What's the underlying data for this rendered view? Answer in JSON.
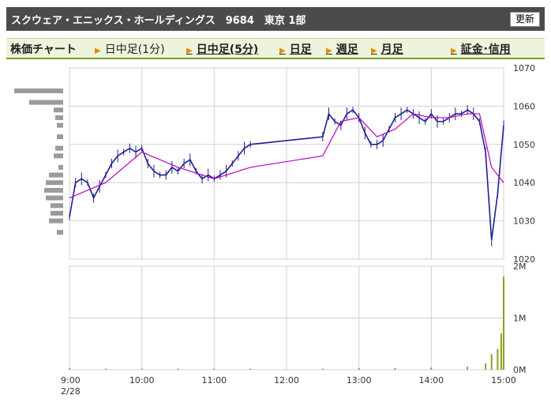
{
  "header": {
    "title": "スクウェア・エニックス・ホールディングス　9684　東京 1部",
    "refresh_label": "更新"
  },
  "nav": {
    "chart_label": "株価チャート",
    "items": [
      {
        "label": "日中足(1分)",
        "link": false
      },
      {
        "label": "日中足(5分)",
        "link": true
      },
      {
        "label": "日足",
        "link": true
      },
      {
        "label": "週足",
        "link": true
      },
      {
        "label": "月足",
        "link": true
      },
      {
        "label": "証金･信用",
        "link": true
      }
    ]
  },
  "colors": {
    "candle": "#1f1f8f",
    "moving_average": "#c000c0",
    "volume": "#8aa21e",
    "grid": "#d0d0d0",
    "volume_profile": "#9a9a9a",
    "nav_accent": "#e48b00"
  },
  "chart_data": [
    {
      "type": "line",
      "title": "",
      "xlabel": "",
      "ylabel": "",
      "y_axis_side": "right",
      "ylim": [
        1020,
        1070
      ],
      "y_ticks": [
        "1070",
        "1060",
        "1050",
        "1040",
        "1030",
        "1020"
      ],
      "x_ticks": [
        "9:00",
        "10:00",
        "11:00",
        "12:00",
        "13:00",
        "14:00",
        "15:00"
      ],
      "date_label": "2/28",
      "grid": true,
      "series": [
        {
          "x": [
            "9:00",
            "9:05",
            "9:10",
            "9:15",
            "9:20",
            "9:25",
            "9:30",
            "9:35",
            "9:40",
            "9:45",
            "9:50",
            "9:55",
            "10:00",
            "10:05",
            "10:10",
            "10:15",
            "10:20",
            "10:25",
            "10:30",
            "10:35",
            "10:40",
            "10:45",
            "10:50",
            "10:55",
            "11:00",
            "11:05",
            "11:10",
            "11:15",
            "11:20",
            "11:25",
            "11:30",
            "12:30",
            "12:35",
            "12:40",
            "12:45",
            "12:50",
            "12:55",
            "13:00",
            "13:05",
            "13:10",
            "13:15",
            "13:20",
            "13:25",
            "13:30",
            "13:35",
            "13:40",
            "13:45",
            "13:50",
            "13:55",
            "14:00",
            "14:05",
            "14:10",
            "14:15",
            "14:20",
            "14:25",
            "14:30",
            "14:35",
            "14:40",
            "14:45",
            "14:50",
            "14:55",
            "15:00"
          ],
          "values": [
            1031,
            1040,
            1041,
            1040,
            1036,
            1039,
            1042,
            1045,
            1047,
            1048,
            1049,
            1048,
            1049,
            1045,
            1043,
            1042,
            1042,
            1044,
            1043,
            1045,
            1046,
            1043,
            1041,
            1042,
            1041,
            1042,
            1043,
            1045,
            1047,
            1049,
            1050,
            1052,
            1058,
            1056,
            1055,
            1058,
            1059,
            1057,
            1053,
            1050,
            1050,
            1051,
            1054,
            1057,
            1058,
            1059,
            1058,
            1057,
            1056,
            1058,
            1056,
            1056,
            1057,
            1058,
            1058,
            1059,
            1058,
            1056,
            1048,
            1025,
            1037,
            1055
          ]
        },
        {
          "x": [
            "9:00",
            "9:30",
            "10:00",
            "10:30",
            "11:00",
            "11:30",
            "12:30",
            "12:45",
            "13:00",
            "13:15",
            "13:30",
            "13:45",
            "14:00",
            "14:15",
            "14:30",
            "14:40",
            "14:50",
            "15:00"
          ],
          "values": [
            1036,
            1040,
            1048,
            1044,
            1041,
            1044,
            1047,
            1056,
            1057,
            1052,
            1054,
            1058,
            1057,
            1057,
            1058,
            1058,
            1044,
            1040
          ]
        }
      ]
    },
    {
      "type": "bar",
      "title": "",
      "ylim": [
        0,
        2000000
      ],
      "y_ticks": [
        "2M",
        "1M",
        "0M"
      ],
      "x": [
        "9:00",
        "9:30",
        "10:00",
        "10:30",
        "11:00",
        "11:30",
        "12:30",
        "13:00",
        "13:30",
        "14:00",
        "14:30",
        "14:45",
        "14:50",
        "14:55",
        "14:58",
        "15:00"
      ],
      "values": [
        30000,
        20000,
        20000,
        20000,
        20000,
        20000,
        20000,
        30000,
        30000,
        40000,
        60000,
        120000,
        300000,
        400000,
        700000,
        1800000
      ]
    },
    {
      "type": "bar",
      "orientation": "horizontal",
      "title": "",
      "price_levels": [
        1064,
        1061,
        1059,
        1057,
        1055,
        1052,
        1049,
        1047,
        1044,
        1042,
        1040,
        1038,
        1036,
        1034,
        1032,
        1030,
        1027
      ],
      "values": [
        62,
        43,
        12,
        10,
        8,
        8,
        10,
        12,
        6,
        18,
        22,
        24,
        22,
        16,
        16,
        18,
        8
      ]
    }
  ]
}
